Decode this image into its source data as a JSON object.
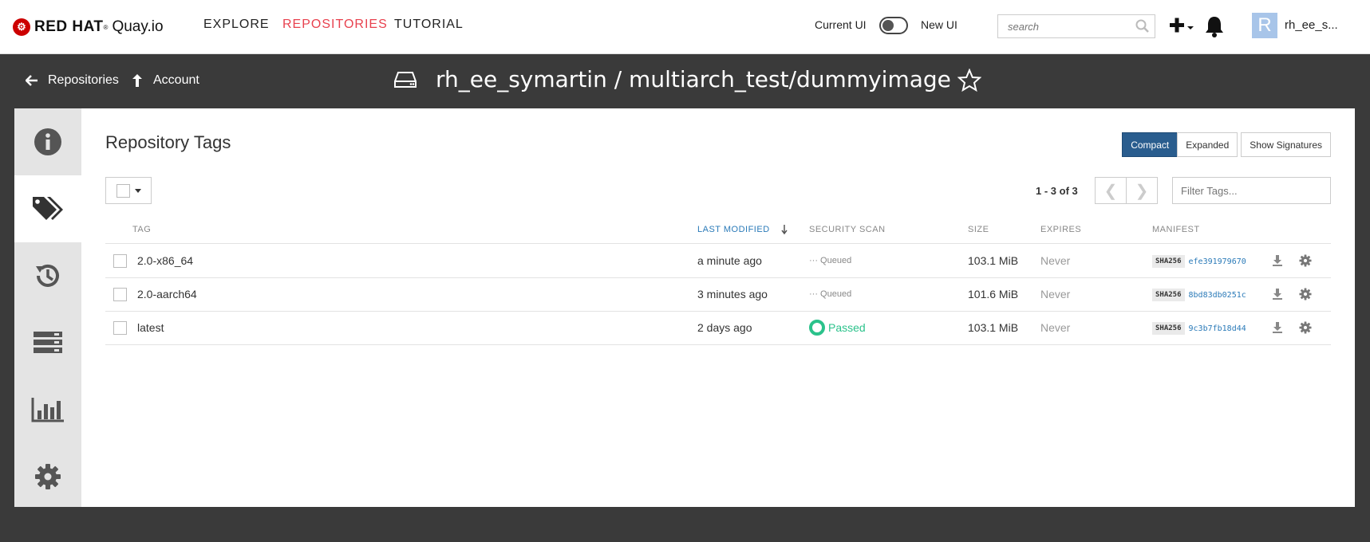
{
  "navbar": {
    "brand": "RED HAT",
    "registered": "®",
    "product": "Quay.io",
    "links": [
      "EXPLORE",
      "REPOSITORIES",
      "TUTORIAL"
    ],
    "current_ui_label": "Current UI",
    "new_ui_label": "New UI",
    "search_placeholder": "search",
    "avatar_letter": "R",
    "username": "rh_ee_s..."
  },
  "header": {
    "back_label": "Repositories",
    "account_label": "Account",
    "repo_title": "rh_ee_symartin / multiarch_test/dummyimage"
  },
  "sidebar": {
    "items": [
      "info-icon",
      "tags-icon",
      "history-icon",
      "builds-icon",
      "usage-icon",
      "settings-icon"
    ],
    "active": "tags-icon"
  },
  "tags_view": {
    "title": "Repository Tags",
    "view_buttons": [
      "Compact",
      "Expanded"
    ],
    "active_view": "Compact",
    "signatures_button": "Show Signatures",
    "page_count": "1 - 3 of 3",
    "prev_glyph": "❮",
    "next_glyph": "❯",
    "filter_placeholder": "Filter Tags...",
    "columns": {
      "tag": "TAG",
      "last_modified": "LAST MODIFIED",
      "security_scan": "SECURITY SCAN",
      "size": "SIZE",
      "expires": "EXPIRES",
      "manifest": "MANIFEST"
    },
    "rows": [
      {
        "tag": "2.0-x86_64",
        "modified": "a minute ago",
        "scan": "Queued",
        "size": "103.1 MiB",
        "expires": "Never",
        "sha_label": "SHA256",
        "sha": "efe391979670"
      },
      {
        "tag": "2.0-aarch64",
        "modified": "3 minutes ago",
        "scan": "Queued",
        "size": "101.6 MiB",
        "expires": "Never",
        "sha_label": "SHA256",
        "sha": "8bd83db0251c"
      },
      {
        "tag": "latest",
        "modified": "2 days ago",
        "scan": "Passed",
        "size": "103.1 MiB",
        "expires": "Never",
        "sha_label": "SHA256",
        "sha": "9c3b7fb18d44"
      }
    ]
  },
  "colors": {
    "accent_red": "#e8414e",
    "primary_blue": "#2a5d8e",
    "link_blue": "#2a7ab8",
    "passed_green": "#2bc28b",
    "dark_bg": "#3a3a3a"
  }
}
